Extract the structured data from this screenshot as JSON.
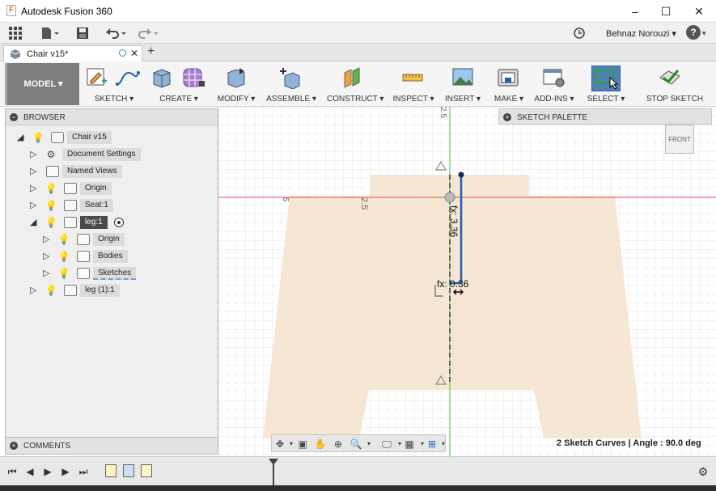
{
  "window": {
    "title": "Autodesk Fusion 360",
    "minimize": "–",
    "maximize": "☐",
    "close": "✕"
  },
  "qat": {
    "user": "Behnaz Norouzi ▾",
    "help": "?"
  },
  "tab": {
    "label": "Chair v15*",
    "add": "+",
    "close": "✕"
  },
  "ribbon": {
    "workspace": "MODEL ▾",
    "groups": [
      "SKETCH ▾",
      "CREATE ▾",
      "MODIFY ▾",
      "ASSEMBLE ▾",
      "CONSTRUCT ▾",
      "INSPECT ▾",
      "INSERT ▾",
      "MAKE ▾",
      "ADD-INS ▾",
      "SELECT ▾",
      "STOP SKETCH"
    ]
  },
  "browser": {
    "title": "BROWSER",
    "root": "Chair v15",
    "items": [
      "Document Settings",
      "Named Views",
      "Origin",
      "Seat:1",
      "leg:1",
      "Origin",
      "Bodies",
      "Sketches",
      "leg (1):1"
    ]
  },
  "comments": {
    "title": "COMMENTS"
  },
  "palette": {
    "title": "SKETCH PALETTE"
  },
  "viewcube": {
    "label": "FRONT"
  },
  "canvas": {
    "dim_vertical": "fx: 3.36",
    "dim_horizontal": "fx: 0.36",
    "grid_label_1": "2.5",
    "grid_label_2": "5",
    "grid_label_top": "2.5"
  },
  "status": {
    "text": "2 Sketch Curves | Angle : 90.0 deg"
  },
  "colors": {
    "accent": "#4f7fb5",
    "axis_red": "#e05050",
    "axis_green": "#44bb44",
    "sketch_blue": "#1f5fb5",
    "body_fill": "#f5e3cc"
  }
}
